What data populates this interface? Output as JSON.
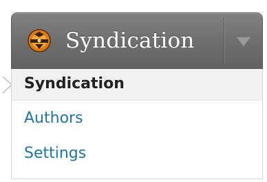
{
  "menu": {
    "title": "Syndication",
    "icon": "syndication-icon",
    "toggle_icon": "triangle-down-icon",
    "current_pointer_icon": "chevron-right-icon",
    "submenu": [
      {
        "label": "Syndication",
        "current": true
      },
      {
        "label": "Authors",
        "current": false
      },
      {
        "label": "Settings",
        "current": false
      }
    ]
  },
  "colors": {
    "header_top": "#828282",
    "header_bottom": "#626262",
    "title_text": "#ffffff",
    "link": "#21759b",
    "current_bg": "#f1f1f1",
    "current_text": "#222222",
    "icon_orange": "#e07b10"
  }
}
